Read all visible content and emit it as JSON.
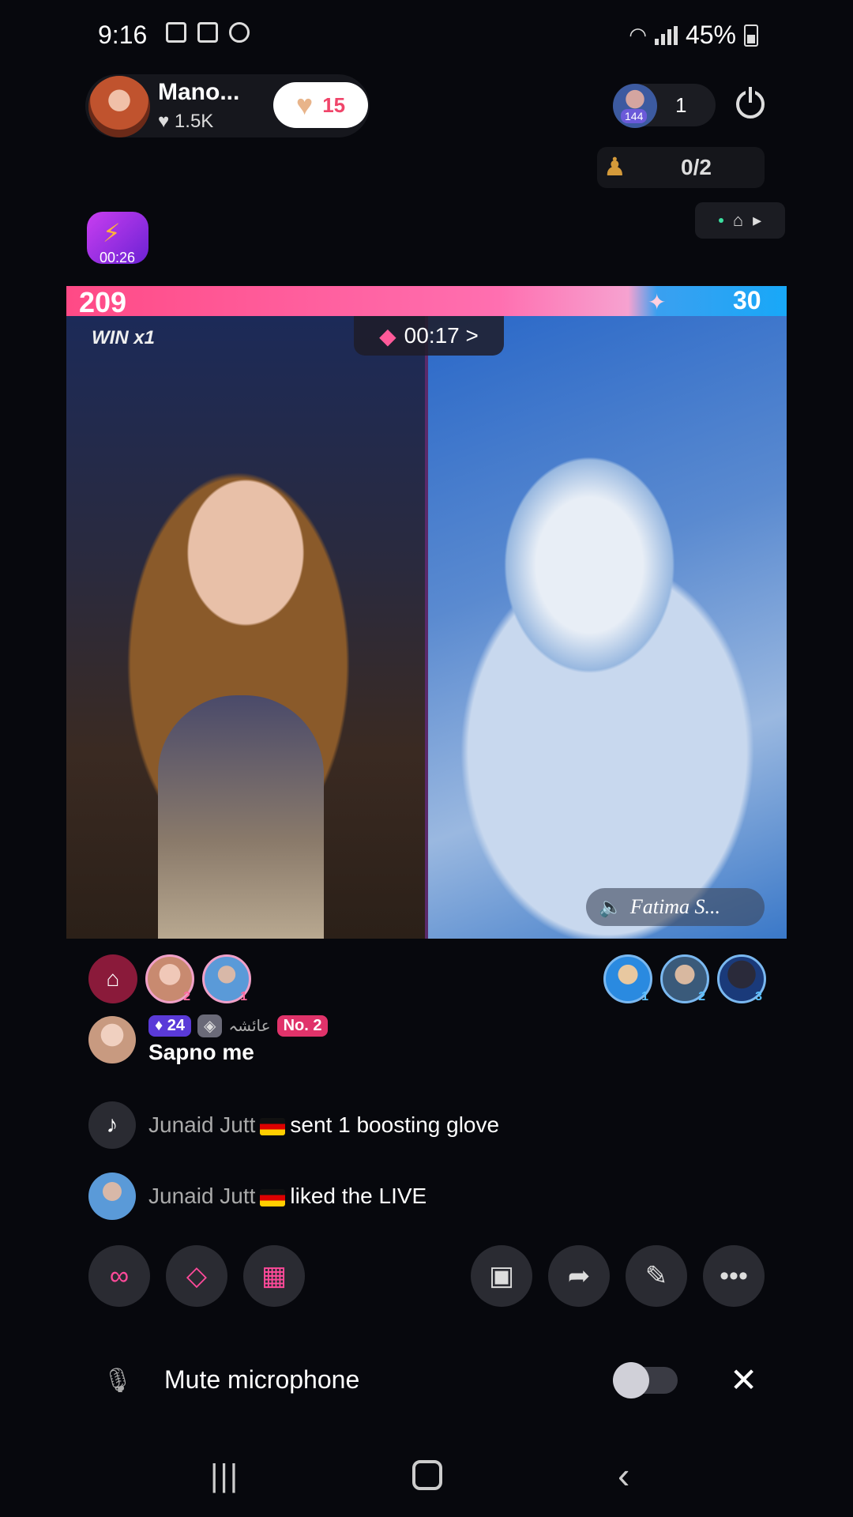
{
  "status_bar": {
    "time": "9:16",
    "battery": "45%"
  },
  "host": {
    "name": "Mano...",
    "likes": "1.5K",
    "follow_count": "15"
  },
  "viewers": {
    "count": "1",
    "badge": "144"
  },
  "guests": {
    "count": "0/2"
  },
  "event": {
    "timer": "00:26"
  },
  "battle": {
    "left_score": "209",
    "right_score": "30",
    "win_label": "WIN x1",
    "timer": "00:17 >",
    "opponent_name": "Fatima S..."
  },
  "supporters": {
    "left_ranks": [
      "2",
      "1"
    ],
    "right_ranks": [
      "1",
      "2",
      "3"
    ]
  },
  "chat": {
    "messages": [
      {
        "level": "24",
        "arabic": "عائشہ",
        "rank": "No. 2",
        "text": "Sapno me"
      },
      {
        "user": "Junaid Jutt",
        "text": "sent 1 boosting glove"
      },
      {
        "user": "Junaid Jutt",
        "text": "liked the LIVE"
      }
    ]
  },
  "mute": {
    "label": "Mute microphone"
  },
  "colors": {
    "accent_pink": "#ff4a86",
    "accent_blue": "#18a8f8",
    "background": "#07080d"
  }
}
